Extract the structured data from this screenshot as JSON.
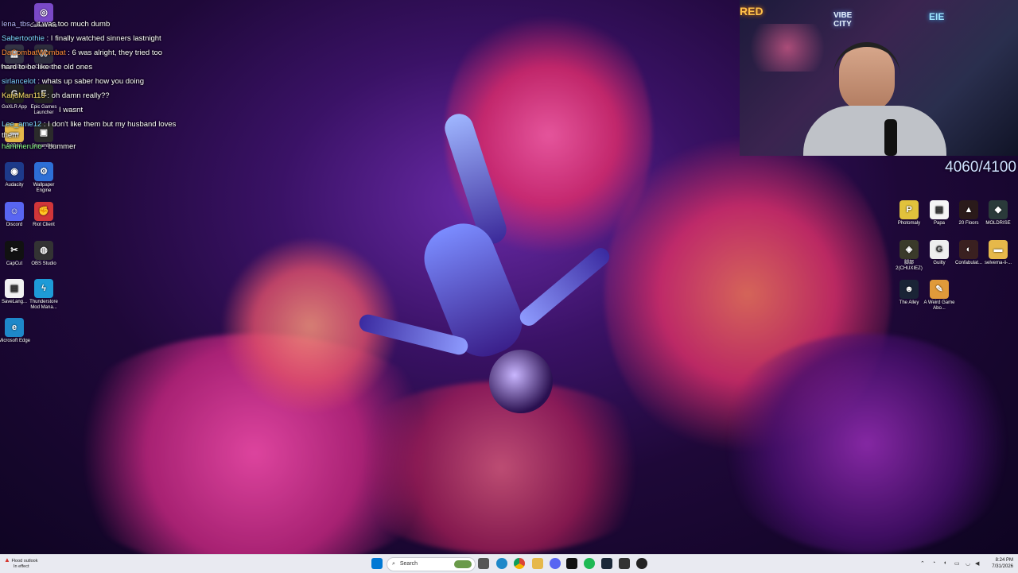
{
  "chat": {
    "messages": [
      {
        "user": "lena_tbs",
        "text": " : it was too much dumb",
        "color": "u5"
      },
      {
        "user": "Sabertoothie",
        "text": " : I finally watched sinners lastnight",
        "color": "u2"
      },
      {
        "user": "DaCombatWombat",
        "text": " : 6 was alright, they tried too",
        "color": "u3"
      },
      {
        "user": "",
        "text": "hard to be like the old ones",
        "color": "u5"
      },
      {
        "user": "sirlancelot",
        "text": " : whats up saber how you doing",
        "color": "u2"
      },
      {
        "user": "KaijuMan113",
        "text": " : oh damn really??",
        "color": "u1"
      },
      {
        "user": "",
        "text": "I wasnt",
        "color": "u5"
      },
      {
        "user": "Lee_ame12",
        "text": " : I don't like them but my husband loves",
        "color": "u2"
      },
      {
        "user": "",
        "text": "them",
        "color": "u5"
      },
      {
        "user": "hammeruno",
        "text": " : bummer",
        "color": "u4"
      }
    ]
  },
  "desktop_left": [
    {
      "label": "Camera Hub",
      "icon": "camera-icon",
      "color": "#7a49c7",
      "glyph": "◎"
    },
    {
      "label": "Stream Deck",
      "icon": "stream-deck-icon",
      "color": "#333344",
      "glyph": "▦"
    },
    {
      "label": "Connect",
      "icon": "connect-icon",
      "color": "#2d2d3d",
      "glyph": "⌘"
    },
    {
      "label": "GoXLR App",
      "icon": "goxlr-icon",
      "color": "#202020",
      "glyph": "G"
    },
    {
      "label": "Epic Games Launcher",
      "icon": "epic-games-icon",
      "color": "#222",
      "glyph": "E"
    },
    {
      "label": "D2D12",
      "icon": "folder-icon",
      "color": "#e6b84a",
      "glyph": "▬"
    },
    {
      "label": "Streamlabs",
      "icon": "streamlabs-icon",
      "color": "#2b2b2b",
      "glyph": "▣"
    },
    {
      "label": "Audacity",
      "icon": "audacity-icon",
      "color": "#1d3a8a",
      "glyph": "◉"
    },
    {
      "label": "Wallpaper Engine",
      "icon": "wallpaper-engine-icon",
      "color": "#2d6fd6",
      "glyph": "⚙"
    },
    {
      "label": "Discord",
      "icon": "discord-icon",
      "color": "#5865f2",
      "glyph": "☺"
    },
    {
      "label": "Riot Client",
      "icon": "riot-client-icon",
      "color": "#d13639",
      "glyph": "✊"
    },
    {
      "label": "CapCut",
      "icon": "capcut-icon",
      "color": "#111",
      "glyph": "✂"
    },
    {
      "label": "OBS Studio",
      "icon": "obs-icon",
      "color": "#333",
      "glyph": "◍"
    },
    {
      "label": "SaveLang...",
      "icon": "file-icon",
      "color": "#f2f2f2",
      "glyph": "▤"
    },
    {
      "label": "Thunderstore Mod Mana...",
      "icon": "thunderstore-icon",
      "color": "#1e9bd7",
      "glyph": "ϟ"
    },
    {
      "label": "Microsoft Edge",
      "icon": "edge-icon",
      "color": "#1e88c9",
      "glyph": "e"
    }
  ],
  "desktop_right": [
    {
      "label": "Photomaly",
      "icon": "photomaly-icon",
      "color": "#e1c23c",
      "glyph": "P"
    },
    {
      "label": "Papa",
      "icon": "file-icon",
      "color": "#f5f5f5",
      "glyph": "▤"
    },
    {
      "label": "20 Floors",
      "icon": "game-icon",
      "color": "#2a1a1a",
      "glyph": "▲"
    },
    {
      "label": "MOLDRISE",
      "icon": "game-icon",
      "color": "#2a3a3a",
      "glyph": "◆"
    },
    {
      "label": "脚部 2(CHUXIEZ)",
      "icon": "game-icon",
      "color": "#3a3a2a",
      "glyph": "◈"
    },
    {
      "label": "Guilty",
      "icon": "game-icon",
      "color": "#eee",
      "glyph": "G"
    },
    {
      "label": "Confabulat...",
      "icon": "game-icon",
      "color": "#3a2020",
      "glyph": "◐"
    },
    {
      "label": "selvema-ii-...",
      "icon": "folder-icon",
      "color": "#e6b84a",
      "glyph": "▬"
    },
    {
      "label": "The Alley",
      "icon": "game-icon",
      "color": "#1a2436",
      "glyph": "☻"
    },
    {
      "label": "A Weird Game Abo...",
      "icon": "game-icon",
      "color": "#e09a3a",
      "glyph": "✎"
    }
  ],
  "webcam": {
    "sign_left": "RED",
    "sign_center": "VIBE CITY",
    "sign_right": "EIE"
  },
  "counter": "4060/4100",
  "taskbar": {
    "weather_line1": "Flood outlook",
    "weather_line2": "In effect",
    "search_placeholder": "Search",
    "time": "8:24 PM",
    "date": "7/31/2026"
  }
}
